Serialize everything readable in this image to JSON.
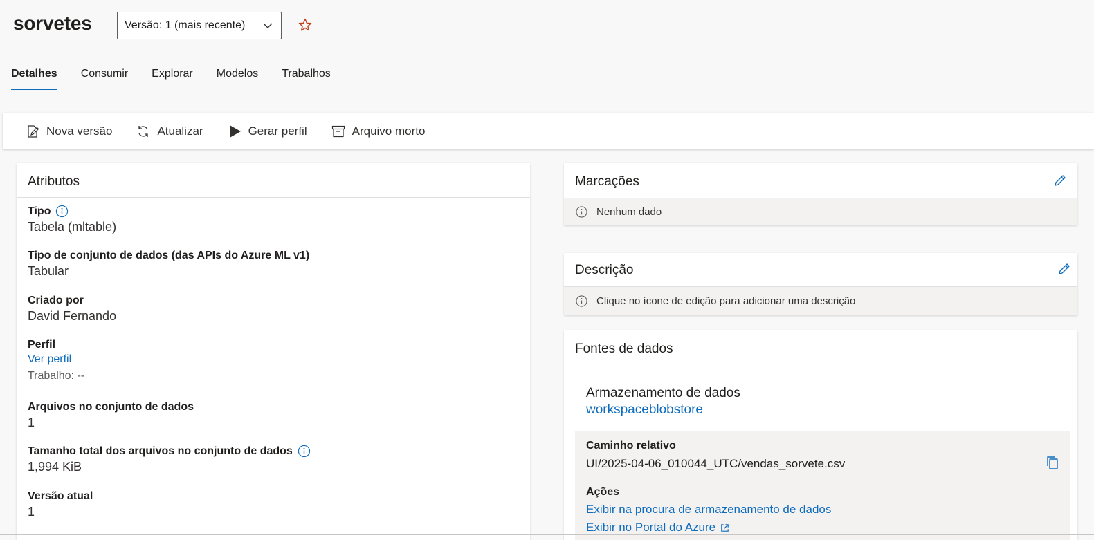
{
  "header": {
    "title": "sorvetes",
    "version_selected": "Versão: 1 (mais recente)"
  },
  "tabs": [
    {
      "label": "Detalhes",
      "active": true
    },
    {
      "label": "Consumir",
      "active": false
    },
    {
      "label": "Explorar",
      "active": false
    },
    {
      "label": "Modelos",
      "active": false
    },
    {
      "label": "Trabalhos",
      "active": false
    }
  ],
  "toolbar": {
    "new_version": "Nova versão",
    "refresh": "Atualizar",
    "generate_profile": "Gerar perfil",
    "archive": "Arquivo morto"
  },
  "attributes": {
    "title": "Atributos",
    "type_label": "Tipo",
    "type_value": "Tabela (mltable)",
    "dataset_type_label": "Tipo de conjunto de dados (das APIs do Azure ML v1)",
    "dataset_type_value": "Tabular",
    "created_by_label": "Criado por",
    "created_by_value": "David Fernando",
    "profile_label": "Perfil",
    "profile_link": "Ver perfil",
    "profile_job": "Trabalho: --",
    "files_label": "Arquivos no conjunto de dados",
    "files_value": "1",
    "size_label": "Tamanho total dos arquivos no conjunto de dados",
    "size_value": "1,994 KiB",
    "current_version_label": "Versão atual",
    "current_version_value": "1"
  },
  "tags": {
    "title": "Marcações",
    "empty_text": "Nenhum dado"
  },
  "description": {
    "title": "Descrição",
    "empty_text": "Clique no ícone de edição para adicionar uma descrição"
  },
  "data_sources": {
    "title": "Fontes de dados",
    "store_label": "Armazenamento de dados",
    "store_link": "workspaceblobstore",
    "relative_path_label": "Caminho relativo",
    "relative_path_value": "UI/2025-04-06_010044_UTC/vendas_sorvete.csv",
    "actions_label": "Ações",
    "action_browse": "Exibir na procura de armazenamento de dados",
    "action_portal": "Exibir no Portal do Azure"
  },
  "colors": {
    "accent": "#0f6cbd",
    "star": "#c43e1c"
  }
}
